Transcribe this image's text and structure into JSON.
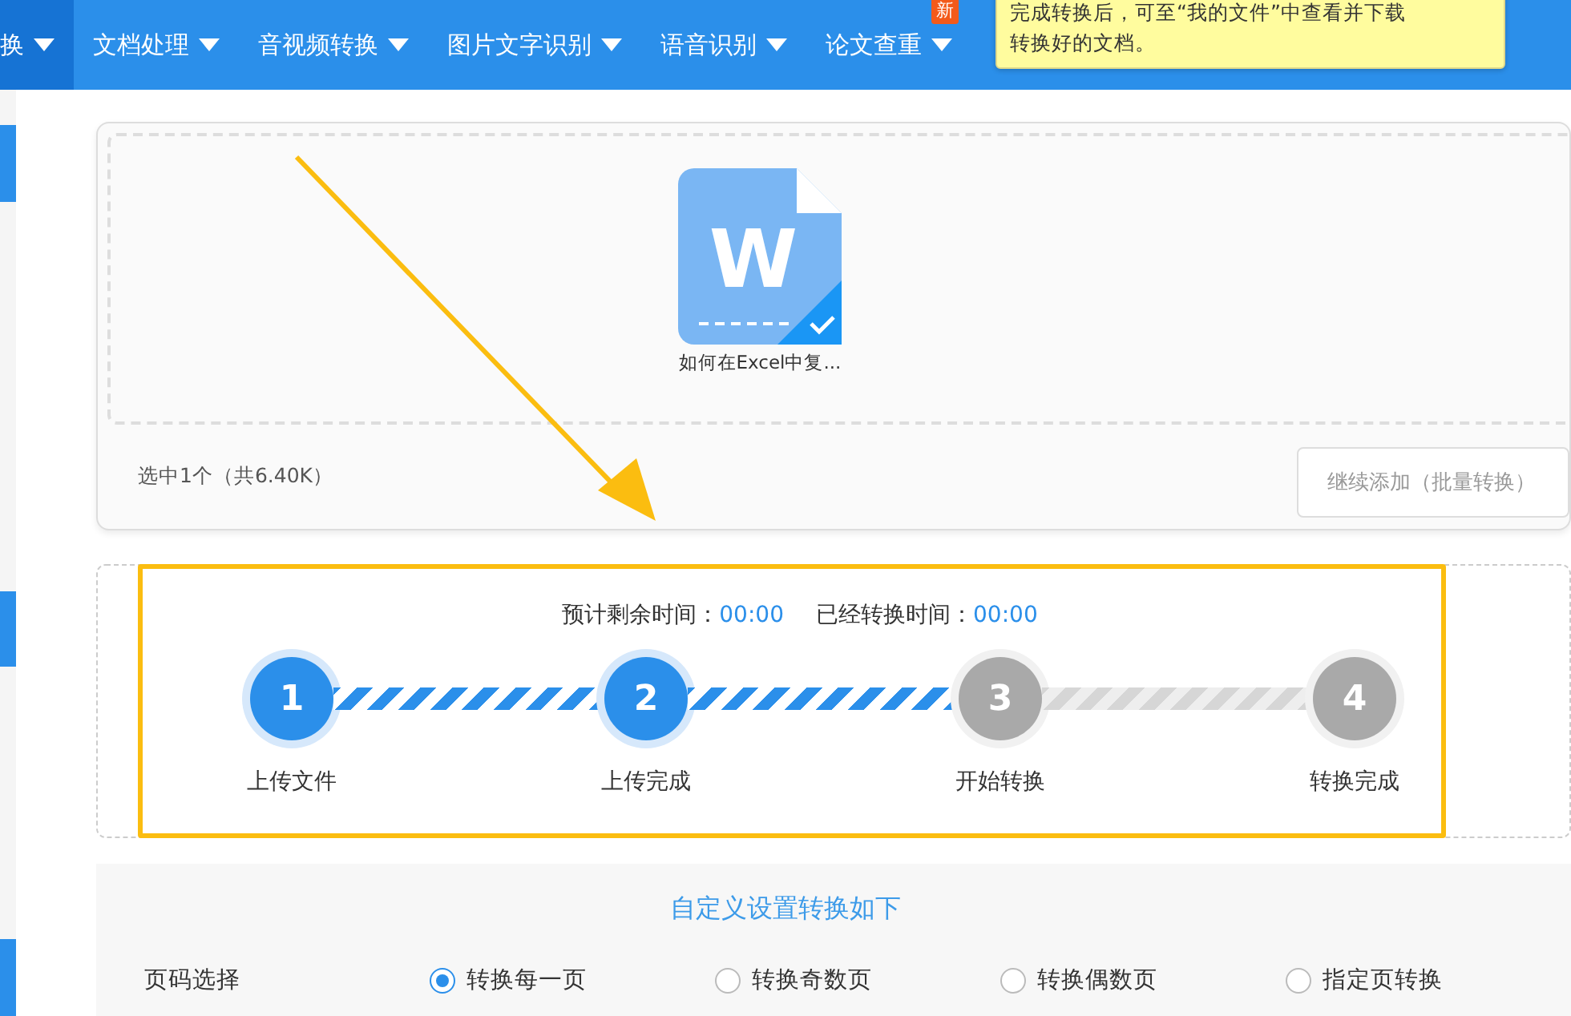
{
  "nav": {
    "items": [
      {
        "label": "换",
        "selected": true
      },
      {
        "label": "文档处理",
        "selected": false
      },
      {
        "label": "音视频转换",
        "selected": false
      },
      {
        "label": "图片文字识别",
        "selected": false
      },
      {
        "label": "语音识别",
        "selected": false
      },
      {
        "label": "论文查重",
        "selected": false,
        "badge": "新"
      }
    ]
  },
  "tooltip": {
    "lines": [
      "完成转换后，可至“我的文件”中查看并下载",
      "转换好的文档。"
    ]
  },
  "upload": {
    "file": {
      "icon_letter": "W",
      "name": "如何在Excel中复...",
      "checked": true
    },
    "summary": "选中1个（共6.40K）",
    "add_button": "继续添加（批量转换）"
  },
  "progress": {
    "remaining_label": "预计剩余时间：",
    "remaining": "00:00",
    "elapsed_label": "已经转换时间：",
    "elapsed": "00:00",
    "steps": [
      {
        "number": "1",
        "label": "上传文件",
        "done": true
      },
      {
        "number": "2",
        "label": "上传完成",
        "done": true
      },
      {
        "number": "3",
        "label": "开始转换",
        "done": false
      },
      {
        "number": "4",
        "label": "转换完成",
        "done": false
      }
    ],
    "connectors": [
      {
        "active": true
      },
      {
        "active": true
      },
      {
        "active": false
      }
    ]
  },
  "settings": {
    "title": "自定义设置转换如下",
    "page_label": "页码选择",
    "options": [
      {
        "label": "转换每一页",
        "selected": true
      },
      {
        "label": "转换奇数页",
        "selected": false
      },
      {
        "label": "转换偶数页",
        "selected": false
      },
      {
        "label": "指定页转换",
        "selected": false
      }
    ]
  }
}
